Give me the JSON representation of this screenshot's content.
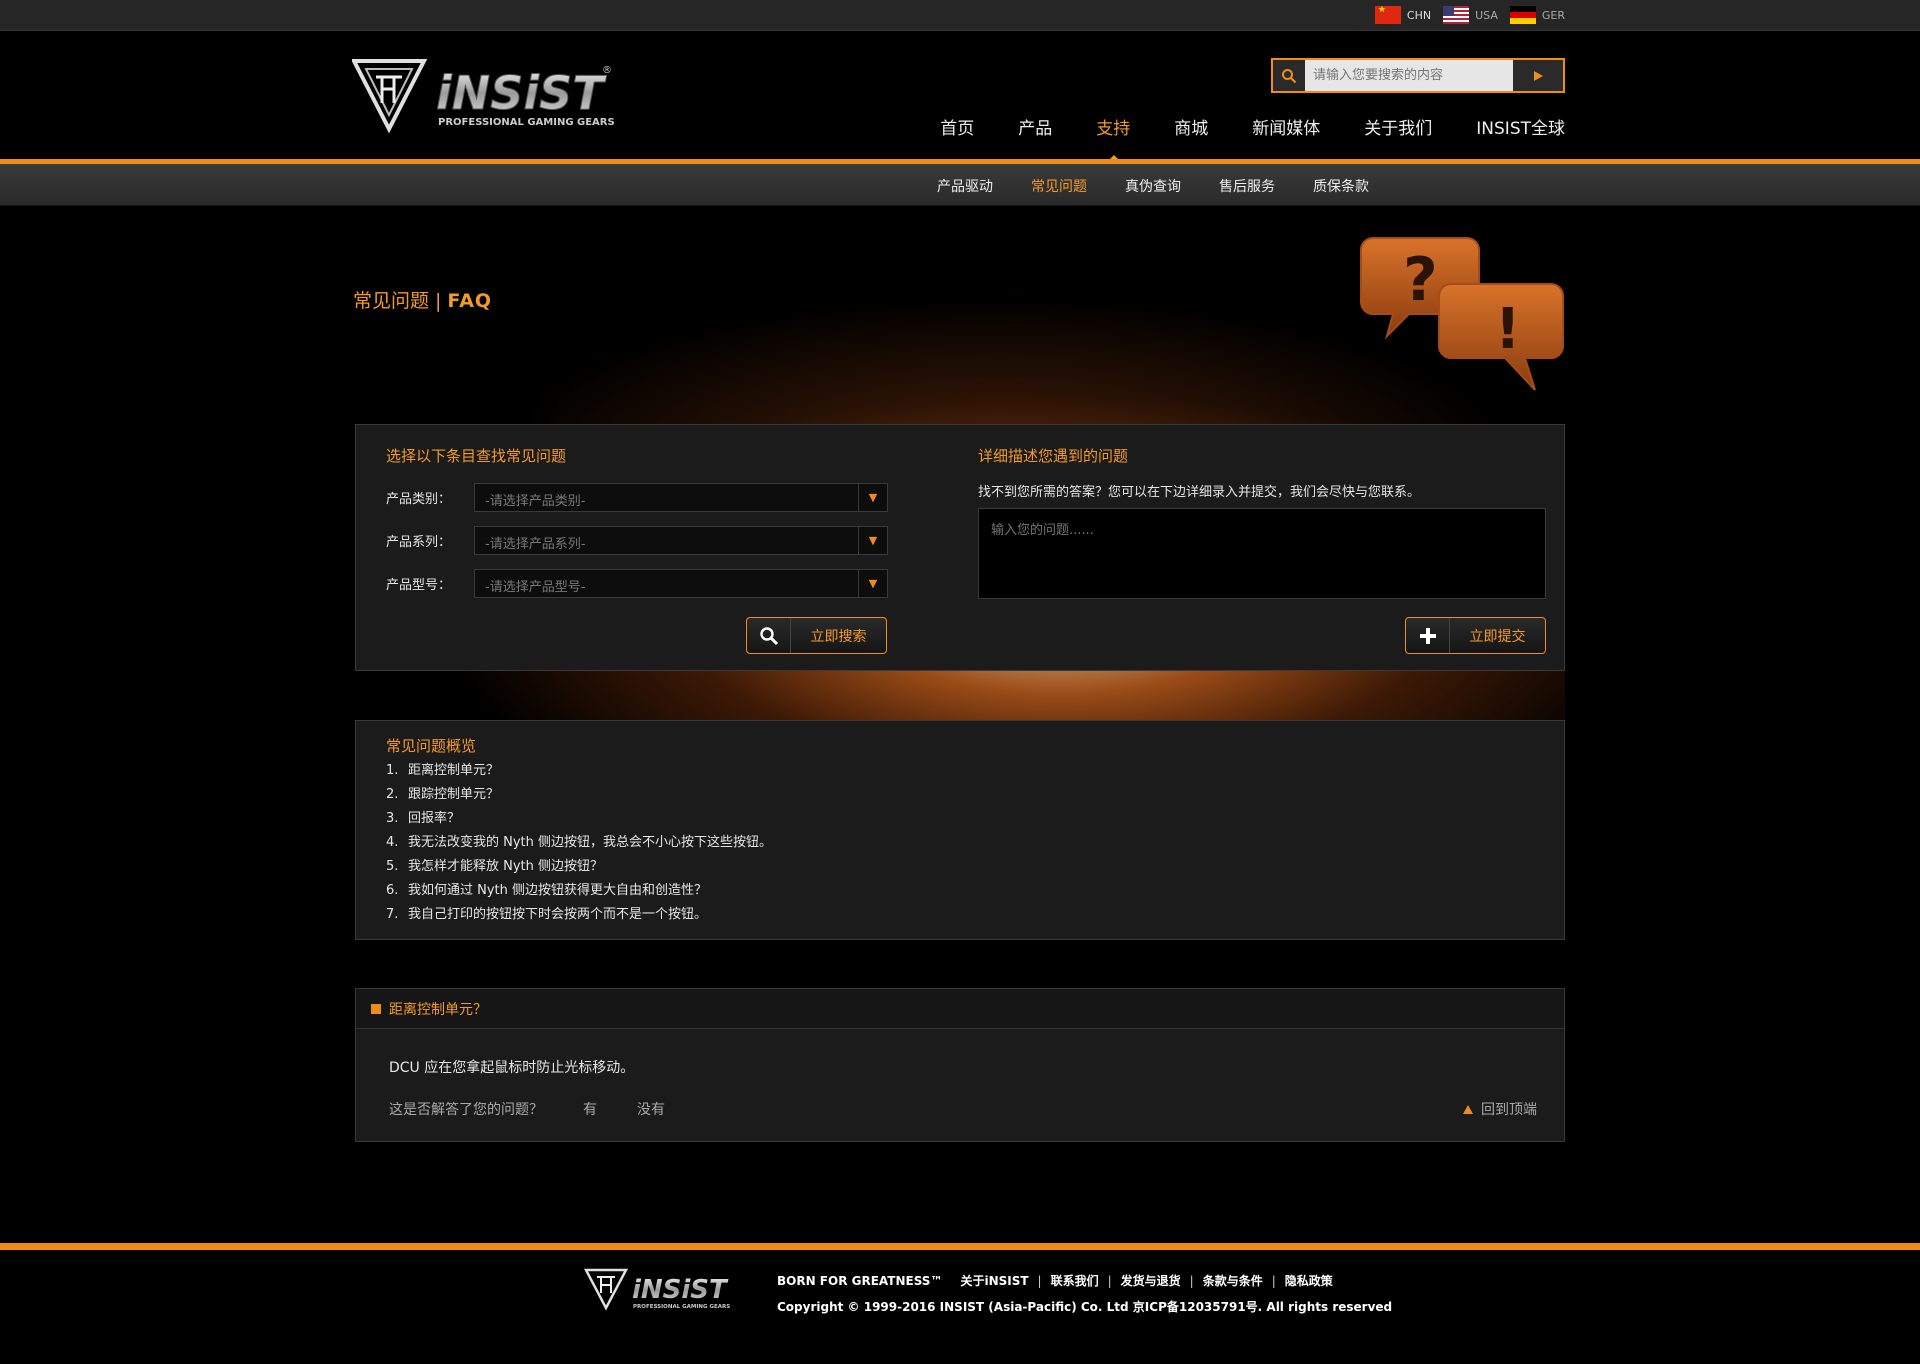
{
  "lang_bar": {
    "items": [
      {
        "code": "CHN",
        "flag": "china-flag"
      },
      {
        "code": "USA",
        "flag": "usa-flag"
      },
      {
        "code": "GER",
        "flag": "germany-flag"
      }
    ]
  },
  "header": {
    "logo_text": "iNSiST",
    "logo_tagline": "PROFESSIONAL GAMING GEARS",
    "search_placeholder": "请输入您要搜索的内容",
    "nav": [
      "首页",
      "产品",
      "支持",
      "商城",
      "新闻媒体",
      "关于我们",
      "INSIST全球"
    ],
    "nav_active": "支持"
  },
  "subnav": {
    "items": [
      "产品驱动",
      "常见问题",
      "真伪查询",
      "售后服务",
      "质保条款"
    ],
    "active": "常见问题"
  },
  "banner": {
    "title_cn": "常见问题",
    "separator": "|",
    "title_en": "FAQ"
  },
  "search_panel": {
    "heading": "选择以下条目查找常见问题",
    "fields": [
      {
        "label": "产品类别：",
        "value": "-请选择产品类别-"
      },
      {
        "label": "产品系列：",
        "value": "-请选择产品系列-"
      },
      {
        "label": "产品型号：",
        "value": "-请选择产品型号-"
      }
    ],
    "search_button": "立即搜索",
    "describe_heading": "详细描述您遇到的问题",
    "describe_text": "找不到您所需的答案？您可以在下边详细录入并提交，我们会尽快与您联系。",
    "textarea_placeholder": "输入您的问题......",
    "submit_button": "立即提交"
  },
  "overview": {
    "title": "常见问题概览",
    "items": [
      "距离控制单元？",
      "跟踪控制单元？",
      "回报率？",
      "我无法改变我的 Nyth 侧边按钮，我总会不小心按下这些按钮。",
      "我怎样才能释放 Nyth 侧边按钮？",
      "我如何通过 Nyth 侧边按钮获得更大自由和创造性？",
      "我自己打印的按钮按下时会按两个而不是一个按钮。"
    ]
  },
  "answer": {
    "question": "距离控制单元？",
    "text": "DCU 应在您拿起鼠标时防止光标移动。",
    "helpful_prompt": "这是否解答了您的问题？",
    "yes": "有",
    "no": "没有",
    "back_to_top": "回到顶端"
  },
  "footer": {
    "brand": "BORN FOR GREATNESS™",
    "links": [
      "关于iNSIST",
      "联系我们",
      "发货与退货",
      "条款与条件",
      "隐私政策"
    ],
    "copyright": "Copyright © 1999-2016 INSIST (Asia-Pacific) Co. Ltd 京ICP备12035791号. All rights reserved"
  },
  "colors": {
    "accent": "#f08c1a",
    "accent_text": "#f39b2a",
    "background": "#000000",
    "panel": "#1b1b1b"
  }
}
